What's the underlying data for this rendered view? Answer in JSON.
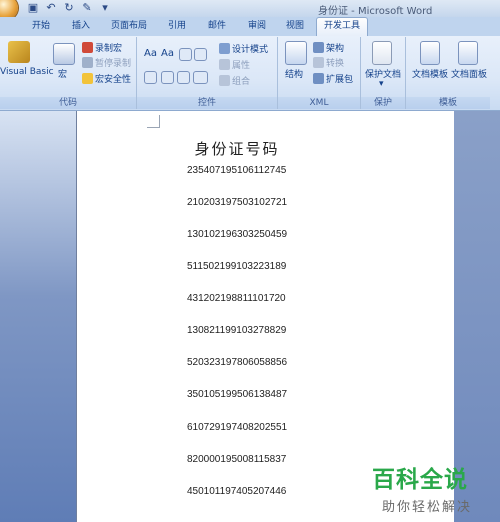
{
  "window": {
    "title": "身份证 - Microsoft Word"
  },
  "tabs": [
    "开始",
    "插入",
    "页面布局",
    "引用",
    "邮件",
    "审阅",
    "视图",
    "开发工具"
  ],
  "active_tab": "开发工具",
  "ribbon": {
    "code": {
      "label": "代码",
      "visual_basic": "Visual Basic",
      "macros": "宏",
      "record_macro": "录制宏",
      "pause_recording": "暂停录制",
      "macro_security": "宏安全性"
    },
    "controls": {
      "label": "控件",
      "text_aa_1": "Aa",
      "text_aa_2": "Aa",
      "design_mode": "设计模式",
      "properties": "属性",
      "group": "组合"
    },
    "xml": {
      "label": "XML",
      "structure": "结构",
      "schema": "架构",
      "transform": "转换",
      "expansion_pack": "扩展包"
    },
    "protect": {
      "label": "保护",
      "protect_document": "保护文档"
    },
    "templates": {
      "label": "模板",
      "document_template": "文档模板",
      "document_panel": "文档面板"
    }
  },
  "document": {
    "title": "身份证号码",
    "ids": [
      "235407195106112745",
      "210203197503102721",
      "130102196303250459",
      "511502199103223189",
      "431202198811101720",
      "130821199103278829",
      "520323197806058856",
      "350105199506138487",
      "610729197408202551",
      "820000195008115837",
      "450101197405207446"
    ]
  },
  "watermark": {
    "main": "百科全说",
    "sub": "助你轻松解决"
  }
}
